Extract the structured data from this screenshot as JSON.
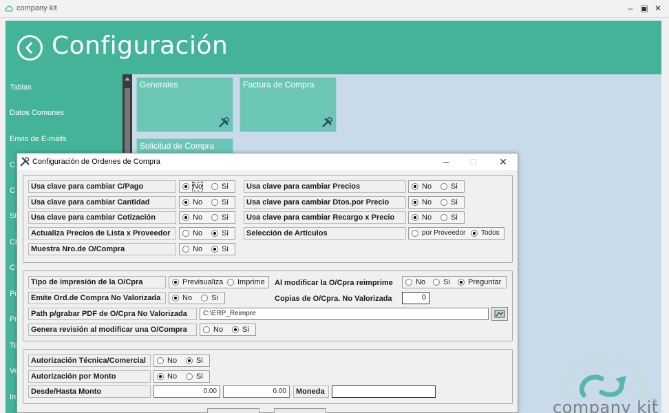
{
  "window": {
    "title": "company kit"
  },
  "header": {
    "title": "Configuración"
  },
  "sidebar": {
    "items": [
      {
        "label": "Tablas"
      },
      {
        "label": "Datos Comunes"
      },
      {
        "label": "Envio de E-mails"
      },
      {
        "label": "C"
      },
      {
        "label": "C"
      },
      {
        "label": "St"
      },
      {
        "label": "Cl"
      },
      {
        "label": "C"
      },
      {
        "label": "Pr"
      },
      {
        "label": "Pr"
      },
      {
        "label": "Te"
      },
      {
        "label": "Ve"
      },
      {
        "label": "In"
      }
    ]
  },
  "tiles": [
    {
      "label": "Generales"
    },
    {
      "label": "Factura de Compra"
    },
    {
      "label": "Solicitud de Compra"
    }
  ],
  "brand": {
    "name": "company kit",
    "reg": "®"
  },
  "dialog": {
    "title": "Configuración de Ordenes de Compra",
    "group1": {
      "left_rows": [
        {
          "label": "Usa clave para cambiar C/Pago",
          "options": [
            "No",
            "Si"
          ],
          "selected": "No"
        },
        {
          "label": "Usa clave para cambiar Cantidad",
          "options": [
            "No",
            "Si"
          ],
          "selected": "No"
        },
        {
          "label": "Usa clave para cambiar Cotización",
          "options": [
            "No",
            "Si"
          ],
          "selected": "No"
        },
        {
          "label": "Actualiza Precios de Lista x Proveedor",
          "options": [
            "No",
            "Si"
          ],
          "selected": "Si"
        },
        {
          "label": "Muestra Nro.de O/Compra",
          "options": [
            "No",
            "Si"
          ],
          "selected": "Si"
        }
      ],
      "right_rows": [
        {
          "label": "Usa clave para cambiar Precios",
          "options": [
            "No",
            "Si"
          ],
          "selected": "No"
        },
        {
          "label": "Usa clave para cambiar Dtos.por Precio",
          "options": [
            "No",
            "Si"
          ],
          "selected": "No"
        },
        {
          "label": "Usa clave para cambiar Recargo x Precio",
          "options": [
            "No",
            "Si"
          ],
          "selected": "No"
        },
        {
          "label": "Selección de Artículos",
          "options": [
            "por Proveedor",
            "Todos"
          ],
          "selected": "Todos"
        }
      ]
    },
    "group2": {
      "tipo_impresion": {
        "label": "Tipo de impresión de la O/Cpra",
        "options": [
          "Previsualiza",
          "Imprime"
        ],
        "selected": "Previsualiza"
      },
      "al_modificar": {
        "label": "Al modificar la O/Cpra reimprime",
        "options": [
          "No",
          "Si",
          "Preguntar"
        ],
        "selected": "Preguntar"
      },
      "emite": {
        "label": "Emite Ord.de Compra No Valorizada",
        "options": [
          "No",
          "Si"
        ],
        "selected": "No"
      },
      "copias": {
        "label": "Copias de O/Cpra. No Valorizada",
        "value": "0"
      },
      "path": {
        "label": "Path p/grabar PDF de O/Cpra No Valorizada",
        "value": "C:\\ERP_Reimpre"
      },
      "genera": {
        "label": "Genera revisión al modificar una O/Compra",
        "options": [
          "No",
          "Si"
        ],
        "selected": "Si"
      }
    },
    "group3": {
      "autorizacion_tecnica": {
        "label": "Autorización Técnica/Comercial",
        "options": [
          "No",
          "Si"
        ],
        "selected": "Si"
      },
      "autorizacion_monto": {
        "label": "Autorización por Monto",
        "options": [
          "No",
          "Si"
        ],
        "selected": "No"
      },
      "desde_hasta": {
        "label": "Desde/Hasta Monto",
        "desde": "0.00",
        "hasta": "0.00"
      },
      "moneda": {
        "label": "Moneda",
        "value": ""
      }
    }
  },
  "colors": {
    "accent": "#43b39a",
    "tile": "#6cc6b6",
    "app_bg": "#c9daea"
  },
  "icons": [
    "back-arrow-icon",
    "wrench-screwdriver-icon",
    "minimize-icon",
    "maximize-icon",
    "close-icon",
    "browse-folder-icon",
    "cloud-logo-icon"
  ]
}
